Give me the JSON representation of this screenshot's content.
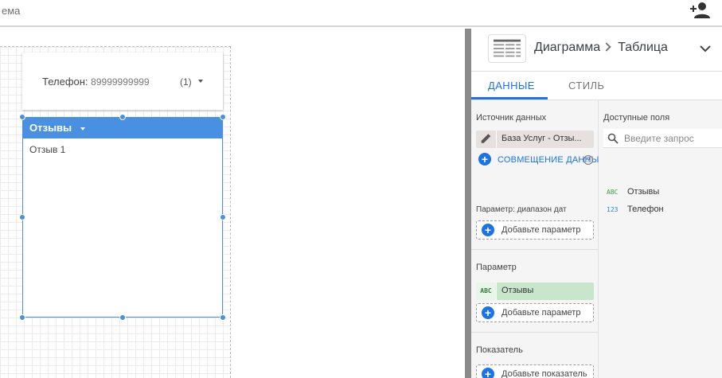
{
  "topbar": {
    "theme_label": "ема",
    "add_user_icon": "person-add-icon"
  },
  "canvas": {
    "scorecard": {
      "label": "Телефон:",
      "value": "89999999999",
      "count": "(1)"
    },
    "table": {
      "header": "Отзывы",
      "rows": [
        "Отзыв 1"
      ]
    }
  },
  "panel": {
    "breadcrumb": {
      "part1": "Диаграмма",
      "part2": "Таблица"
    },
    "tabs": {
      "data": "ДАННЫЕ",
      "style": "СТИЛЬ"
    },
    "data_source": {
      "title": "Источник данных",
      "name": "База Услуг - Отзы...",
      "blend_label": "СОВМЕЩЕНИЕ ДАННЫХ",
      "help": "?"
    },
    "date_range": {
      "title": "Параметр: диапазон дат",
      "add_label": "Добавьте параметр"
    },
    "dimension": {
      "title": "Параметр",
      "field": "Отзывы",
      "field_type": "ABC",
      "add_label": "Добавьте параметр"
    },
    "metric": {
      "title": "Показатель",
      "add_label": "Добавьте показатель"
    },
    "available": {
      "title": "Доступные поля",
      "search_placeholder": "Введите запрос",
      "fields": [
        {
          "type": "ABC",
          "name": "Отзывы"
        },
        {
          "type": "123",
          "name": "Телефон"
        }
      ]
    }
  },
  "colors": {
    "accent": "#1a73e8",
    "table_header": "#4a90e2",
    "dimension_chip": "#c8e6c9",
    "source_chip": "#e6e1de"
  }
}
